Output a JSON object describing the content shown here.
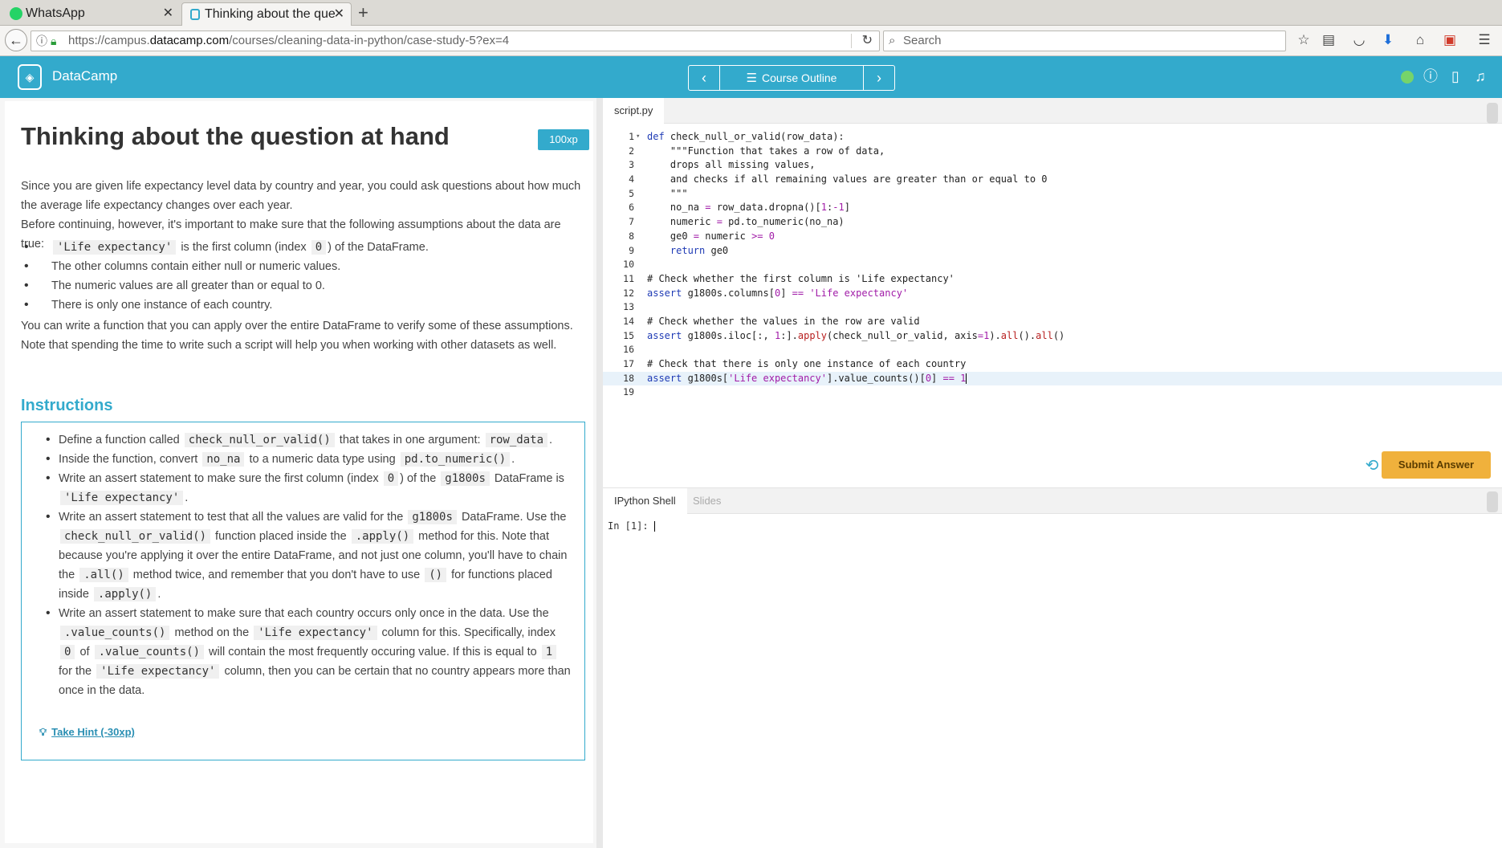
{
  "browser": {
    "tabs": [
      {
        "title": "WhatsApp",
        "active": false
      },
      {
        "title": "Thinking about the que",
        "active": true
      }
    ],
    "url_prefix": "https://campus.",
    "url_domain": "datacamp.com",
    "url_path": "/courses/cleaning-data-in-python/case-study-5?ex=4",
    "search_placeholder": "Search"
  },
  "header": {
    "brand": "DataCamp",
    "course_outline": "Course Outline",
    "status_color": "#76d46a",
    "accent_color": "#33aacc"
  },
  "exercise": {
    "title": "Thinking about the question at hand",
    "xp": "100xp",
    "paragraph1": "Since you are given life expectancy level data by country and year, you could ask questions about how much the average life expectancy changes over each year.",
    "paragraph2": "Before continuing, however, it's important to make sure that the following assumptions about the data are true:",
    "assumptions": {
      "a1_code": "'Life expectancy'",
      "a1_pre": " is the first column (index ",
      "a1_code2": "0",
      "a1_post": ") of the DataFrame.",
      "a2": "The other columns contain either null or numeric values.",
      "a3": "The numeric values are all greater than or equal to 0.",
      "a4": "There is only one instance of each country."
    },
    "paragraph3": "You can write a function that you can apply over the entire DataFrame to verify some of these assumptions. Note that spending the time to write such a script will help you when working with other datasets as well.",
    "instructions_heading": "Instructions",
    "instructions": {
      "i1_a": "Define a function called ",
      "i1_code": "check_null_or_valid()",
      "i1_b": " that takes in one argument: ",
      "i1_code2": "row_data",
      "i1_c": ".",
      "i2_a": "Inside the function, convert ",
      "i2_code": "no_na",
      "i2_b": " to a numeric data type using ",
      "i2_code2": "pd.to_numeric()",
      "i2_c": ".",
      "i3_a": "Write an assert statement to make sure the first column (index ",
      "i3_code": "0",
      "i3_b": ") of the ",
      "i3_code2": "g1800s",
      "i3_c": " DataFrame is ",
      "i3_code3": "'Life expectancy'",
      "i3_d": ".",
      "i4_a": "Write an assert statement to test that all the values are valid for the ",
      "i4_code": "g1800s",
      "i4_b": " DataFrame. Use the ",
      "i4_code2": "check_null_or_valid()",
      "i4_c": " function placed inside the ",
      "i4_code3": ".apply()",
      "i4_d": " method for this. Note that because you're applying it over the entire DataFrame, and not just one column, you'll have to chain the ",
      "i4_code4": ".all()",
      "i4_e": " method twice, and remember that you don't have to use ",
      "i4_code5": "()",
      "i4_f": " for functions placed inside ",
      "i4_code6": ".apply()",
      "i4_g": ".",
      "i5_a": "Write an assert statement to make sure that each country occurs only once in the data. Use the ",
      "i5_code": ".value_counts()",
      "i5_b": " method on the ",
      "i5_code2": "'Life expectancy'",
      "i5_c": " column for this. Specifically, index ",
      "i5_code3": "0",
      "i5_d": " of ",
      "i5_code4": ".value_counts()",
      "i5_e": " will contain the most frequently occuring value. If this is equal to ",
      "i5_code5": "1",
      "i5_f": " for the ",
      "i5_code6": "'Life expectancy'",
      "i5_g": " column, then you can be certain that no country appears more than once in the data."
    },
    "hint": "Take Hint (-30xp)"
  },
  "editor": {
    "tab": "script.py",
    "line_numbers": [
      "1",
      "2",
      "3",
      "4",
      "5",
      "6",
      "7",
      "8",
      "9",
      "10",
      "11",
      "12",
      "13",
      "14",
      "15",
      "16",
      "17",
      "18",
      "19"
    ],
    "code": {
      "l1_def": "def",
      "l1_rest": " check_null_or_valid(row_data):",
      "l2": "    \"\"\"Function that takes a row of data,",
      "l3": "    drops all missing values,",
      "l4": "    and checks if all remaining values are greater than or equal to 0",
      "l5": "    \"\"\"",
      "l6_a": "    no_na ",
      "l6_op": "=",
      "l6_b": " row_data.dropna()[",
      "l6_n1": "1",
      "l6_c": ":",
      "l6_n2": "-1",
      "l6_d": "]",
      "l7_a": "    numeric ",
      "l7_op": "=",
      "l7_b": " pd.to_numeric(no_na)",
      "l8_a": "    ge0 ",
      "l8_op": "=",
      "l8_b": " numeric ",
      "l8_op2": ">=",
      "l8_n": " 0",
      "l9_kw": "    return",
      "l9_b": " ge0",
      "l11": "# Check whether the first column is 'Life expectancy'",
      "l12_kw": "assert",
      "l12_b": " g1800s.columns[",
      "l12_n": "0",
      "l12_c": "] ",
      "l12_op": "==",
      "l12_s": " 'Life expectancy'",
      "l14": "# Check whether the values in the row are valid",
      "l15_kw": "assert",
      "l15_b": " g1800s.iloc[:, ",
      "l15_n": "1",
      "l15_c": ":].",
      "l15_fn": "apply",
      "l15_d": "(check_null_or_valid, axis",
      "l15_op": "=",
      "l15_n2": "1",
      "l15_e": ").",
      "l15_fn2": "all",
      "l15_f": "().",
      "l15_fn3": "all",
      "l15_g": "()",
      "l17": "# Check that there is only one instance of each country",
      "l18_kw": "assert",
      "l18_b": " g1800s[",
      "l18_s": "'Life expectancy'",
      "l18_c": "].value_counts()[",
      "l18_n": "0",
      "l18_d": "] ",
      "l18_op": "==",
      "l18_n2": " 1"
    },
    "submit_label": "Submit Answer",
    "submit_color": "#f0b13c"
  },
  "shell": {
    "tabs": [
      "IPython Shell",
      "Slides"
    ],
    "prompt": "In [1]:"
  }
}
